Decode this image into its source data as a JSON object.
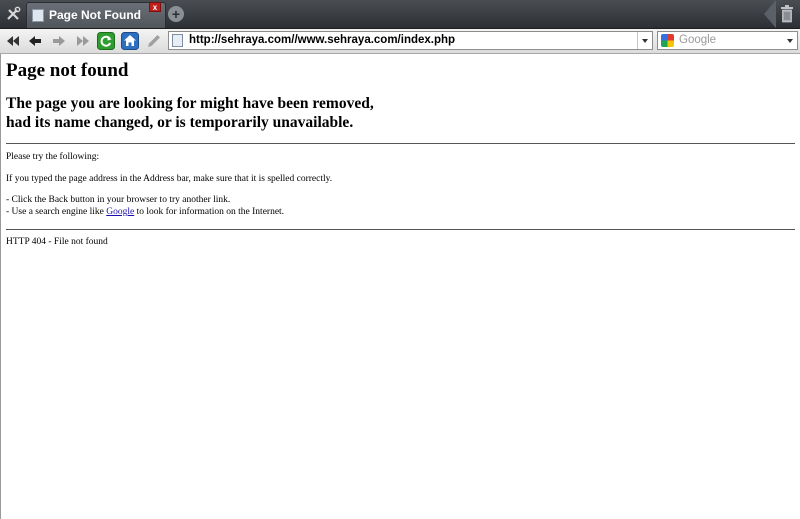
{
  "browser": {
    "tab": {
      "title": "Page Not Found",
      "close_label": "x"
    },
    "new_tab_label": "+",
    "address": {
      "url": "http://sehraya.com//www.sehraya.com/index.php"
    },
    "search": {
      "placeholder": "Google"
    }
  },
  "icons": {
    "menu": "tools-icon",
    "favicon": "page-icon",
    "close": "close-icon",
    "new_tab": "plus-icon",
    "trash": "trash-icon",
    "rewind": "rewind-icon",
    "back": "back-arrow-icon",
    "forward": "forward-arrow-icon",
    "fast_forward": "fast-forward-icon",
    "reload": "reload-icon",
    "home": "home-icon",
    "edit": "pen-icon",
    "search_engine": "google-icon"
  },
  "page": {
    "title": "Page not found",
    "subtitle_line1": "The page you are looking for might have been removed,",
    "subtitle_line2": "had its name changed, or is temporarily unavailable.",
    "intro": "Please try the following:",
    "tip_address": "If you typed the page address in the Address bar, make sure that it is spelled correctly.",
    "tip_back": "- Click the Back button in your browser to try another link.",
    "tip_search_prefix": "- Use a search engine like ",
    "tip_search_link": "Google",
    "tip_search_suffix": " to look for information on the Internet.",
    "error": "HTTP 404 - File not found"
  },
  "colors": {
    "link": "#1a0dab",
    "tab_close": "#c0201c",
    "reload_green": "#2f9e2f",
    "home_blue": "#2e6fc0"
  }
}
